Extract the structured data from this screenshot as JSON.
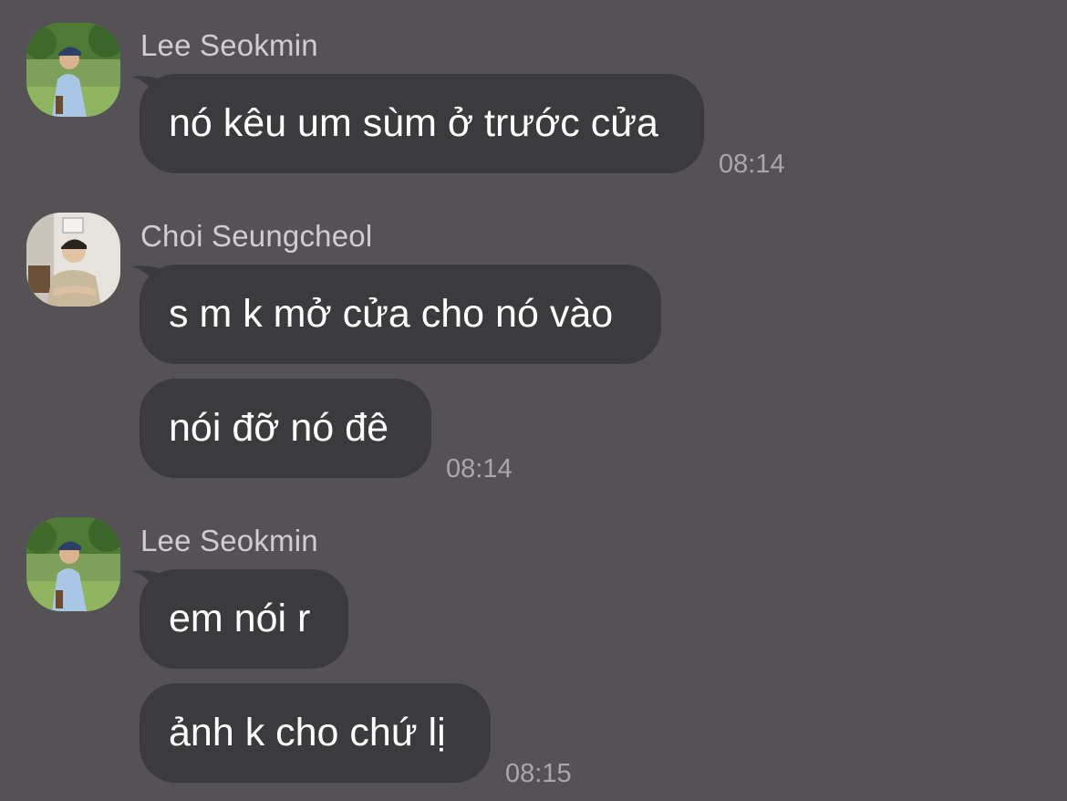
{
  "messages": [
    {
      "sender": "Lee Seokmin",
      "avatar": "avatar-lee-seokmin",
      "bubbles": [
        "nó kêu um sùm ở trước cửa"
      ],
      "time": "08:14"
    },
    {
      "sender": "Choi Seungcheol",
      "avatar": "avatar-choi-seungcheol",
      "bubbles": [
        "s m k mở cửa cho nó vào",
        "nói đỡ nó đê"
      ],
      "time": "08:14"
    },
    {
      "sender": "Lee Seokmin",
      "avatar": "avatar-lee-seokmin",
      "bubbles": [
        "em nói r",
        "ảnh k cho chứ lị"
      ],
      "time": "08:15"
    }
  ],
  "colors": {
    "background": "#545254",
    "bubble": "#3b3a3c",
    "text": "#ffffff",
    "sender": "#cfcdcf",
    "time": "#a9a7a9"
  }
}
